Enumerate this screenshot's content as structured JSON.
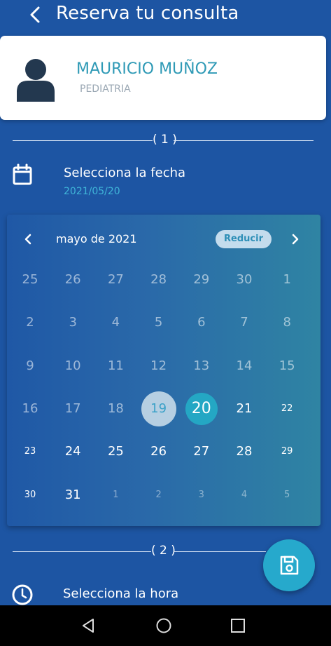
{
  "header": {
    "title": "Reserva tu consulta"
  },
  "doctor": {
    "name": "MAURICIO MUÑOZ",
    "specialty": "PEDIATRIA"
  },
  "step1": {
    "number": "( 1 )",
    "title": "Selecciona la fecha",
    "selected_date": "2021/05/20"
  },
  "calendar": {
    "month_label": "mayo de 2021",
    "reduce_label": "Reducir",
    "weeks": [
      [
        "25",
        "26",
        "27",
        "28",
        "29",
        "30",
        "1"
      ],
      [
        "2",
        "3",
        "4",
        "5",
        "6",
        "7",
        "8"
      ],
      [
        "9",
        "10",
        "11",
        "12",
        "13",
        "14",
        "15"
      ],
      [
        "16",
        "17",
        "18",
        "19",
        "20",
        "21",
        "22"
      ],
      [
        "23",
        "24",
        "25",
        "26",
        "27",
        "28",
        "29"
      ],
      [
        "30",
        "31",
        "1",
        "2",
        "3",
        "4",
        "5"
      ]
    ],
    "today": "19",
    "selected": "20"
  },
  "step2": {
    "number": "( 2 )",
    "title": "Selecciona la hora"
  },
  "colors": {
    "background": "#1d55a3",
    "accent": "#24a7c4",
    "card": "#ffffff",
    "doctor_name": "#2f9ab6"
  },
  "icons": {
    "back": "chevron-left-icon",
    "avatar": "user-avatar-icon",
    "calendar": "calendar-icon",
    "clock": "clock-icon",
    "save": "save-icon",
    "nav_back": "triangle-back-icon",
    "nav_home": "circle-home-icon",
    "nav_recents": "square-recents-icon"
  }
}
